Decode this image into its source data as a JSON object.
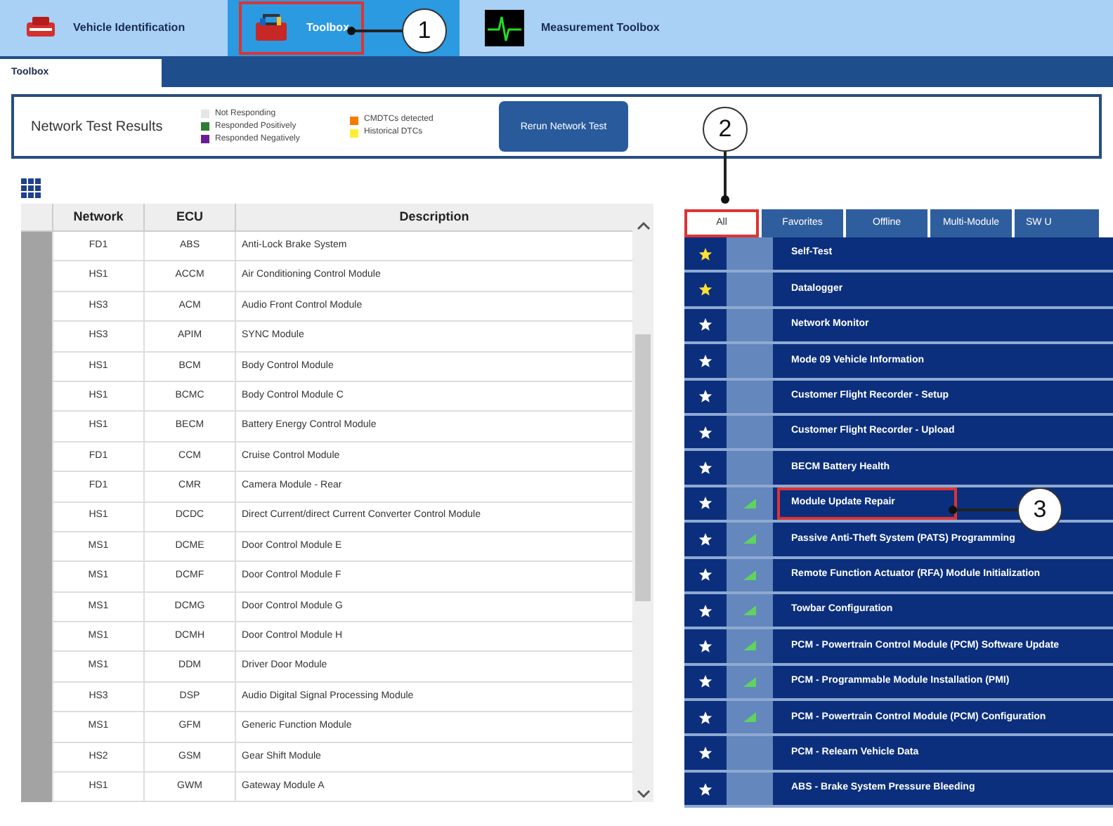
{
  "top_tabs": [
    {
      "label": "Vehicle Identification",
      "kind": "vehicle",
      "selected": false,
      "highlighted": false
    },
    {
      "label": "Toolbox",
      "kind": "toolbox",
      "selected": true,
      "highlighted": true
    },
    {
      "label": "Measurement Toolbox",
      "kind": "scope",
      "selected": false,
      "highlighted": false
    }
  ],
  "sub_tab": {
    "label": "Toolbox"
  },
  "network_test": {
    "title": "Network Test Results",
    "legend": [
      {
        "label": "Not Responding",
        "color": "#e6e6e6"
      },
      {
        "label": "Responded Positively",
        "color": "#2e7d32"
      },
      {
        "label": "Responded Negatively",
        "color": "#6a1b9a"
      },
      {
        "label": "CMDTCs detected",
        "color": "#f57c00"
      },
      {
        "label": "Historical DTCs",
        "color": "#ffee33"
      }
    ],
    "button": "Rerun Network Test"
  },
  "ecu_table": {
    "columns": [
      "Network",
      "ECU",
      "Description"
    ],
    "rows": [
      [
        "FD1",
        "ABS",
        "Anti-Lock Brake System"
      ],
      [
        "HS1",
        "ACCM",
        "Air Conditioning Control Module"
      ],
      [
        "HS3",
        "ACM",
        "Audio Front Control Module"
      ],
      [
        "HS3",
        "APIM",
        "SYNC Module"
      ],
      [
        "HS1",
        "BCM",
        "Body Control Module"
      ],
      [
        "HS1",
        "BCMC",
        "Body Control Module C"
      ],
      [
        "HS1",
        "BECM",
        "Battery Energy Control Module"
      ],
      [
        "FD1",
        "CCM",
        "Cruise Control Module"
      ],
      [
        "FD1",
        "CMR",
        "Camera Module - Rear"
      ],
      [
        "HS1",
        "DCDC",
        "Direct Current/direct Current Converter Control Module"
      ],
      [
        "MS1",
        "DCME",
        "Door Control Module E"
      ],
      [
        "MS1",
        "DCMF",
        "Door Control Module F"
      ],
      [
        "MS1",
        "DCMG",
        "Door Control Module G"
      ],
      [
        "MS1",
        "DCMH",
        "Door Control Module H"
      ],
      [
        "MS1",
        "DDM",
        "Driver Door Module"
      ],
      [
        "HS3",
        "DSP",
        "Audio Digital Signal Processing Module"
      ],
      [
        "MS1",
        "GFM",
        "Generic Function Module"
      ],
      [
        "HS2",
        "GSM",
        "Gear Shift Module"
      ],
      [
        "HS1",
        "GWM",
        "Gateway Module A"
      ]
    ]
  },
  "tool_tabs": [
    {
      "label": "All",
      "selected": true,
      "highlighted": true
    },
    {
      "label": "Favorites",
      "selected": false,
      "highlighted": false
    },
    {
      "label": "Offline",
      "selected": false,
      "highlighted": false
    },
    {
      "label": "Multi-Module",
      "selected": false,
      "highlighted": false
    },
    {
      "label": "SW U",
      "selected": false,
      "highlighted": false
    }
  ],
  "tools": [
    {
      "label": "Self-Test",
      "favorite": true,
      "signal": false,
      "highlighted": false
    },
    {
      "label": "Datalogger",
      "favorite": true,
      "signal": false,
      "highlighted": false
    },
    {
      "label": "Network Monitor",
      "favorite": false,
      "signal": false,
      "highlighted": false
    },
    {
      "label": "Mode 09 Vehicle Information",
      "favorite": false,
      "signal": false,
      "highlighted": false
    },
    {
      "label": "Customer Flight Recorder - Setup",
      "favorite": false,
      "signal": false,
      "highlighted": false
    },
    {
      "label": "Customer Flight Recorder - Upload",
      "favorite": false,
      "signal": false,
      "highlighted": false
    },
    {
      "label": "BECM Battery Health",
      "favorite": false,
      "signal": false,
      "highlighted": false
    },
    {
      "label": "Module Update Repair",
      "favorite": false,
      "signal": true,
      "highlighted": true
    },
    {
      "label": "Passive Anti-Theft System (PATS) Programming",
      "favorite": false,
      "signal": true,
      "highlighted": false
    },
    {
      "label": "Remote Function Actuator (RFA) Module Initialization",
      "favorite": false,
      "signal": true,
      "highlighted": false
    },
    {
      "label": "Towbar Configuration",
      "favorite": false,
      "signal": true,
      "highlighted": false
    },
    {
      "label": "PCM - Powertrain Control Module (PCM) Software Update",
      "favorite": false,
      "signal": true,
      "highlighted": false
    },
    {
      "label": "PCM - Programmable Module Installation (PMI)",
      "favorite": false,
      "signal": true,
      "highlighted": false
    },
    {
      "label": "PCM - Powertrain Control Module (PCM) Configuration",
      "favorite": false,
      "signal": true,
      "highlighted": false
    },
    {
      "label": "PCM - Relearn Vehicle Data",
      "favorite": false,
      "signal": false,
      "highlighted": false
    },
    {
      "label": "ABS - Brake System Pressure Bleeding",
      "favorite": false,
      "signal": false,
      "highlighted": false
    }
  ],
  "callouts": [
    "1",
    "2",
    "3"
  ]
}
